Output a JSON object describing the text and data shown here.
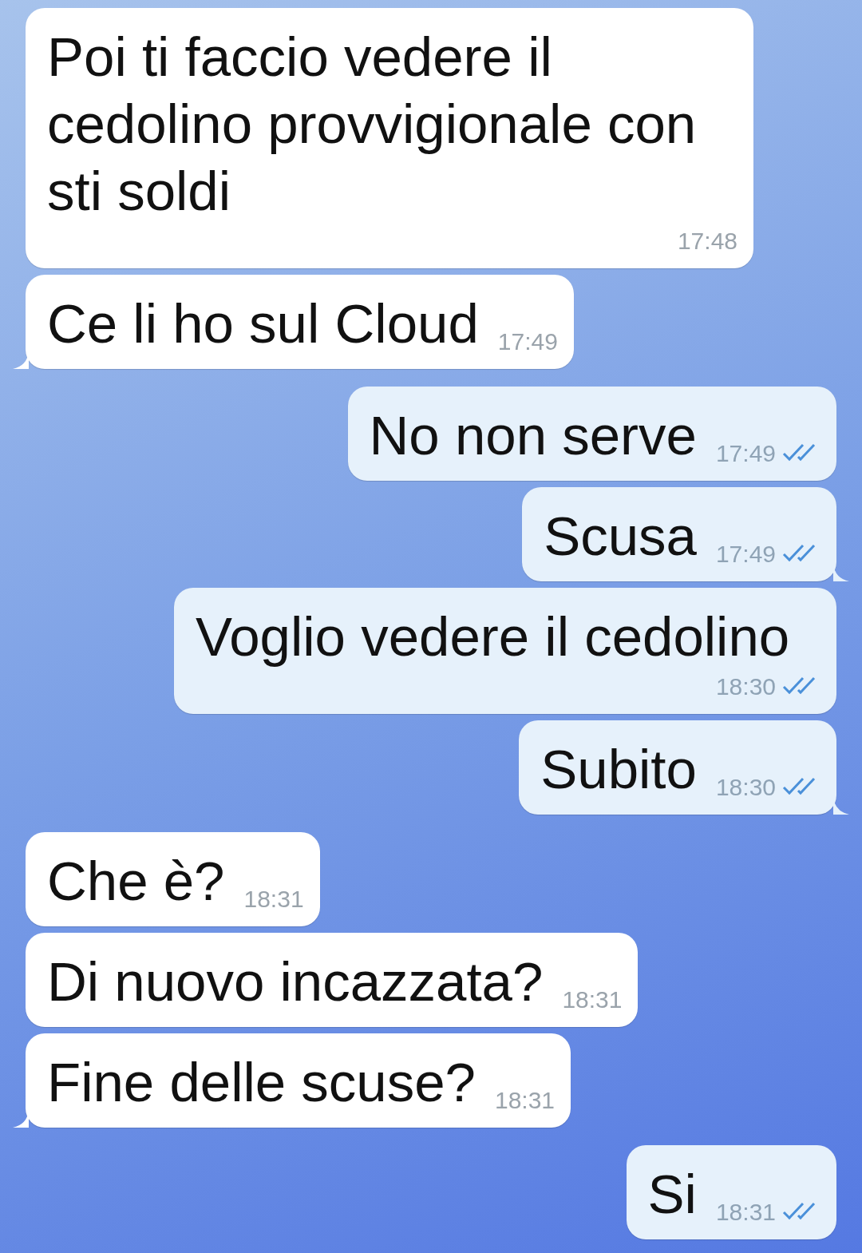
{
  "messages": [
    {
      "kind": "incoming",
      "text": "Poi ti faccio vedere il cedolino provvigionale con sti soldi",
      "time": "17:48",
      "tail": false
    },
    {
      "kind": "incoming",
      "text": "Ce li ho sul Cloud",
      "time": "17:49",
      "tail": true
    },
    {
      "kind": "outgoing",
      "text": "No non serve",
      "time": "17:49",
      "read": true,
      "tail": false
    },
    {
      "kind": "outgoing",
      "text": "Scusa",
      "time": "17:49",
      "read": true,
      "tail": true
    },
    {
      "kind": "outgoing",
      "text": "Voglio vedere il cedolino",
      "time": "18:30",
      "read": true,
      "tail": false
    },
    {
      "kind": "outgoing",
      "text": "Subito",
      "time": "18:30",
      "read": true,
      "tail": true
    },
    {
      "kind": "incoming",
      "text": "Che è?",
      "time": "18:31",
      "tail": false
    },
    {
      "kind": "incoming",
      "text": "Di nuovo incazzata?",
      "time": "18:31",
      "tail": false
    },
    {
      "kind": "incoming",
      "text": "Fine delle scuse?",
      "time": "18:31",
      "tail": true
    },
    {
      "kind": "outgoing",
      "text": "Si",
      "time": "18:31",
      "read": true,
      "tail": false
    }
  ]
}
